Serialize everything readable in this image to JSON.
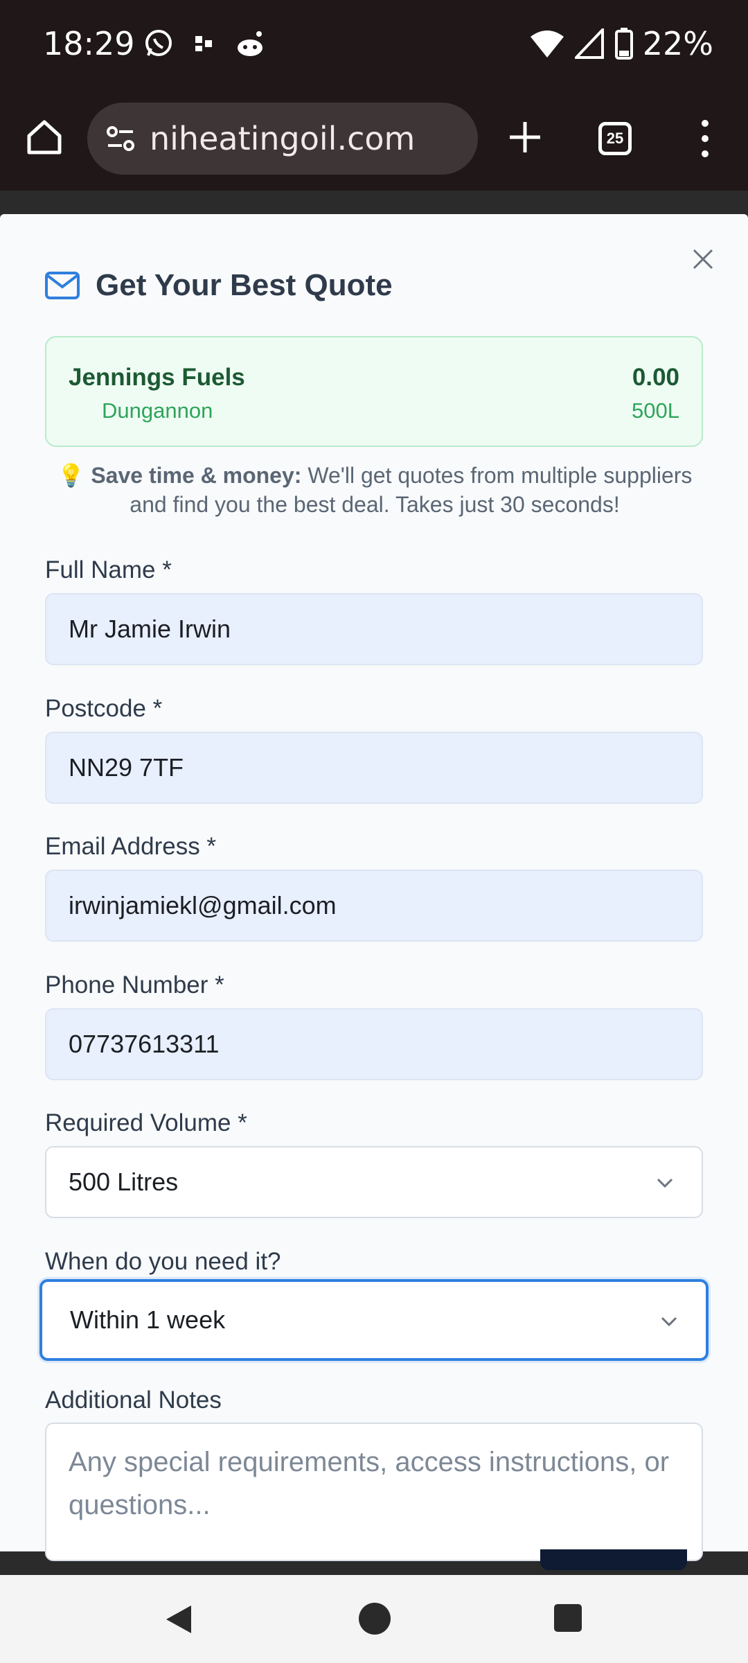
{
  "status_bar": {
    "time": "18:29",
    "battery": "22%",
    "icons": [
      "whatsapp-icon",
      "app-icon",
      "reddit-icon",
      "wifi-icon",
      "signal-icon",
      "battery-icon"
    ]
  },
  "browser": {
    "url": "niheatingoil.com",
    "tab_count": "25"
  },
  "modal": {
    "title": "Get Your Best Quote",
    "supplier": {
      "name": "Jennings Fuels",
      "location": "Dungannon",
      "price": "0.00",
      "volume": "500L"
    },
    "save_note_bold": "Save time & money:",
    "save_note_text": " We'll get quotes from multiple suppliers and find you the best deal. Takes just 30 seconds!",
    "fields": {
      "full_name": {
        "label": "Full Name *",
        "value": "Mr Jamie Irwin"
      },
      "postcode": {
        "label": "Postcode *",
        "value": "NN29 7TF"
      },
      "email": {
        "label": "Email Address *",
        "value": "irwinjamiekl@gmail.com"
      },
      "phone": {
        "label": "Phone Number *",
        "value": "07737613311"
      },
      "volume": {
        "label": "Required Volume *",
        "value": "500 Litres"
      },
      "when": {
        "label": "When do you need it?",
        "value": "Within 1 week"
      },
      "notes": {
        "label": "Additional Notes",
        "placeholder": "Any special requirements, access instructions, or questions..."
      }
    }
  },
  "colors": {
    "accent": "#2f7fde",
    "supplier_green": "#1c5a33",
    "supplier_light": "#2ea55a"
  }
}
